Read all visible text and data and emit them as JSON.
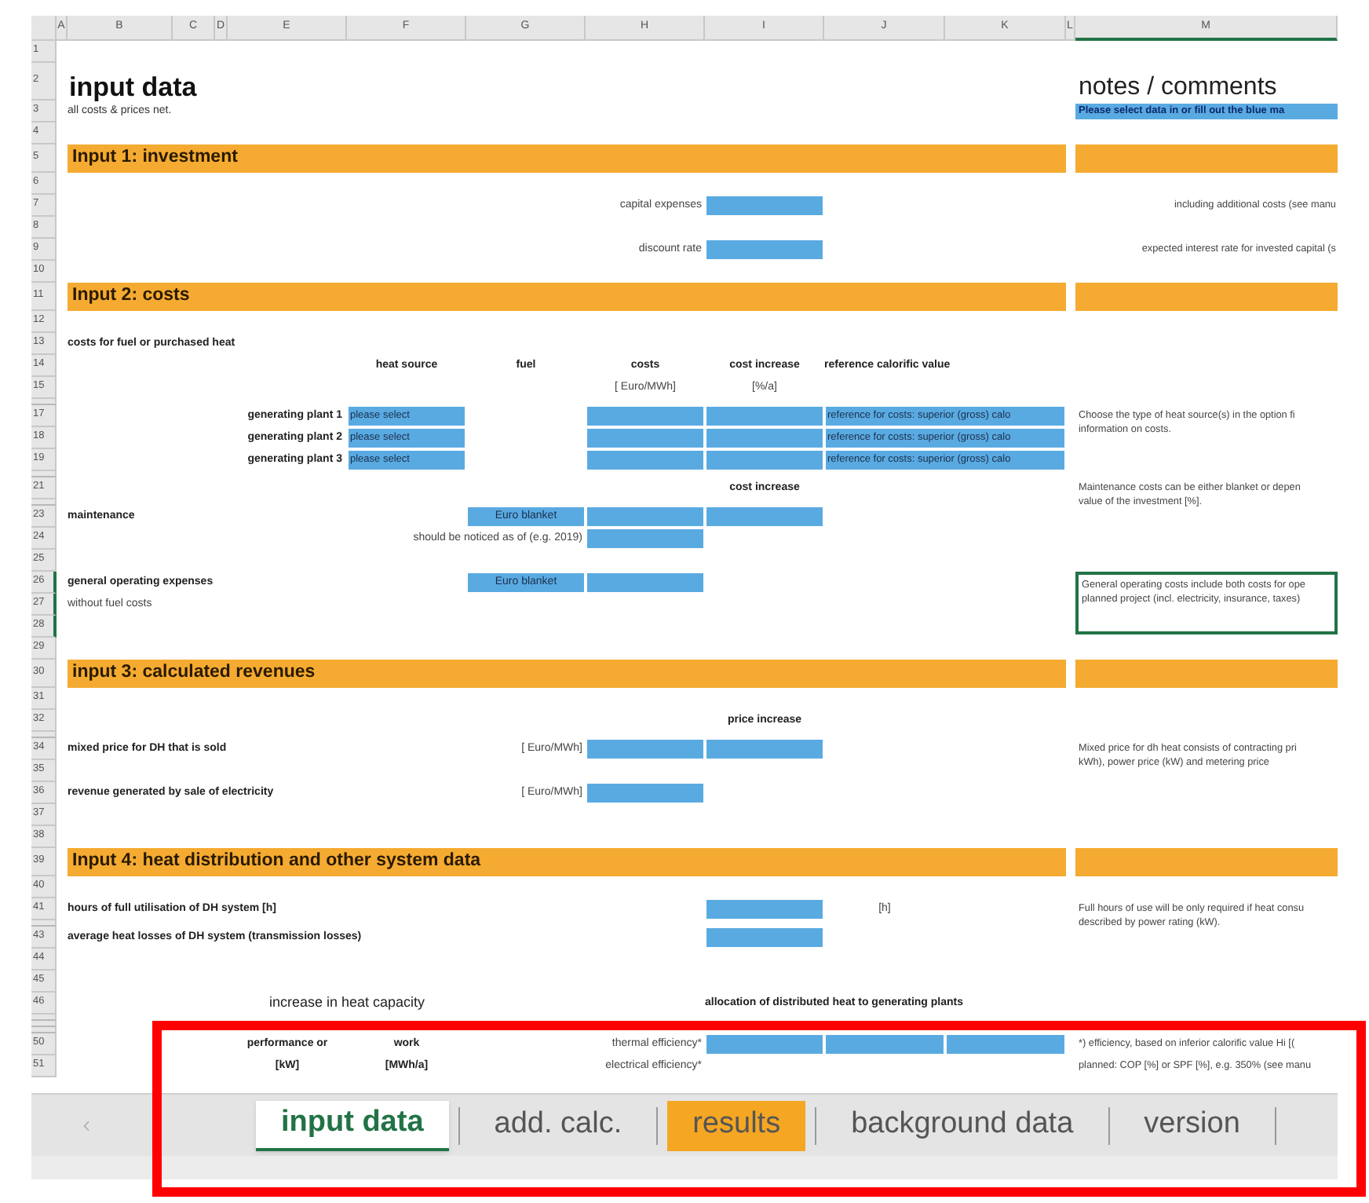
{
  "sheet": {
    "columns": [
      {
        "letter": "A",
        "selected": false
      },
      {
        "letter": "B",
        "selected": false
      },
      {
        "letter": "C",
        "selected": false
      },
      {
        "letter": "D",
        "selected": false
      },
      {
        "letter": "E",
        "selected": false
      },
      {
        "letter": "F",
        "selected": false
      },
      {
        "letter": "G",
        "selected": false
      },
      {
        "letter": "H",
        "selected": false
      },
      {
        "letter": "I",
        "selected": false
      },
      {
        "letter": "J",
        "selected": false
      },
      {
        "letter": "K",
        "selected": false
      },
      {
        "letter": "L",
        "selected": false
      },
      {
        "letter": "M",
        "selected": true
      }
    ],
    "rows": [
      {
        "number": "1",
        "kind": "normal",
        "selected": false
      },
      {
        "number": "2",
        "kind": "title",
        "selected": false,
        "cells": [
          {
            "kind": "empty"
          },
          {
            "kind": "title",
            "text": "input data"
          },
          {
            "kind": "merged"
          },
          {
            "kind": "merged"
          },
          {
            "kind": "merged"
          },
          {
            "kind": "empty"
          },
          {
            "kind": "empty"
          },
          {
            "kind": "empty"
          },
          {
            "kind": "empty"
          },
          {
            "kind": "empty"
          },
          {
            "kind": "empty"
          },
          {
            "kind": "empty"
          },
          {
            "kind": "heading",
            "text": "notes / comments"
          }
        ]
      },
      {
        "number": "3",
        "kind": "normal",
        "selected": false,
        "cells": [
          {
            "kind": "empty"
          },
          {
            "kind": "small",
            "text": "all costs & prices net."
          },
          {
            "kind": "merged"
          },
          {
            "kind": "merged"
          },
          {
            "kind": "merged"
          },
          {
            "kind": "empty"
          },
          {
            "kind": "empty"
          },
          {
            "kind": "empty"
          },
          {
            "kind": "empty"
          },
          {
            "kind": "empty"
          },
          {
            "kind": "empty"
          },
          {
            "kind": "empty"
          },
          {
            "kind": "highlight",
            "text": "Please select data in or fill out the blue ma"
          }
        ]
      },
      {
        "number": "4",
        "kind": "normal",
        "selected": false
      },
      {
        "number": "5",
        "kind": "section",
        "selected": false,
        "cells": [
          {
            "kind": "empty"
          },
          {
            "kind": "section",
            "text": "Input 1: investment"
          },
          {
            "kind": "merged"
          },
          {
            "kind": "merged"
          },
          {
            "kind": "merged"
          },
          {
            "kind": "merged"
          },
          {
            "kind": "merged"
          },
          {
            "kind": "merged"
          },
          {
            "kind": "merged"
          },
          {
            "kind": "merged"
          },
          {
            "kind": "merged"
          },
          {
            "kind": "empty"
          },
          {
            "kind": "band"
          }
        ]
      },
      {
        "number": "6",
        "kind": "normal",
        "selected": false
      },
      {
        "number": "7",
        "kind": "normal",
        "selected": false,
        "cells": [
          {
            "kind": "empty"
          },
          {
            "kind": "empty"
          },
          {
            "kind": "empty"
          },
          {
            "kind": "empty"
          },
          {
            "kind": "empty"
          },
          {
            "kind": "empty"
          },
          {
            "kind": "right",
            "text": "capital expenses"
          },
          {
            "kind": "merged"
          },
          {
            "kind": "input"
          },
          {
            "kind": "empty"
          },
          {
            "kind": "empty"
          },
          {
            "kind": "empty"
          },
          {
            "kind": "note-right",
            "selected": false,
            "lines": [
              "including additional costs (see manu"
            ]
          }
        ]
      },
      {
        "number": "8",
        "kind": "normal",
        "selected": false
      },
      {
        "number": "9",
        "kind": "normal",
        "selected": false,
        "cells": [
          {
            "kind": "empty"
          },
          {
            "kind": "empty"
          },
          {
            "kind": "empty"
          },
          {
            "kind": "empty"
          },
          {
            "kind": "empty"
          },
          {
            "kind": "empty"
          },
          {
            "kind": "right",
            "text": "discount rate"
          },
          {
            "kind": "merged"
          },
          {
            "kind": "input"
          },
          {
            "kind": "empty"
          },
          {
            "kind": "empty"
          },
          {
            "kind": "empty"
          },
          {
            "kind": "note-right",
            "selected": false,
            "lines": [
              "expected interest rate for invested capital (s"
            ]
          }
        ]
      },
      {
        "number": "10",
        "kind": "normal",
        "selected": false
      },
      {
        "number": "11",
        "kind": "section",
        "selected": false,
        "cells": [
          {
            "kind": "empty"
          },
          {
            "kind": "section",
            "text": "Input 2: costs"
          },
          {
            "kind": "merged"
          },
          {
            "kind": "merged"
          },
          {
            "kind": "merged"
          },
          {
            "kind": "merged"
          },
          {
            "kind": "merged"
          },
          {
            "kind": "merged"
          },
          {
            "kind": "merged"
          },
          {
            "kind": "merged"
          },
          {
            "kind": "merged"
          },
          {
            "kind": "empty"
          },
          {
            "kind": "band"
          }
        ]
      },
      {
        "number": "12",
        "kind": "normal",
        "selected": false
      },
      {
        "number": "13",
        "kind": "normal",
        "selected": false,
        "cells": [
          {
            "kind": "empty"
          },
          {
            "kind": "label",
            "text": "costs for fuel or purchased heat"
          },
          {
            "kind": "merged"
          },
          {
            "kind": "merged"
          },
          {
            "kind": "merged"
          }
        ]
      },
      {
        "number": "14",
        "kind": "normal",
        "selected": false,
        "cells": [
          {
            "kind": "empty"
          },
          {
            "kind": "empty"
          },
          {
            "kind": "empty"
          },
          {
            "kind": "empty"
          },
          {
            "kind": "empty"
          },
          {
            "kind": "header",
            "text": "heat source"
          },
          {
            "kind": "header",
            "text": "fuel"
          },
          {
            "kind": "header",
            "text": "costs"
          },
          {
            "kind": "header",
            "text": "cost increase"
          },
          {
            "kind": "label",
            "text": "reference calorific value"
          },
          {
            "kind": "merged"
          }
        ]
      },
      {
        "number": "15",
        "kind": "normal",
        "selected": false,
        "cells": [
          {
            "kind": "empty"
          },
          {
            "kind": "empty"
          },
          {
            "kind": "empty"
          },
          {
            "kind": "empty"
          },
          {
            "kind": "empty"
          },
          {
            "kind": "empty"
          },
          {
            "kind": "empty"
          },
          {
            "kind": "unit",
            "text": "[ Euro/MWh]"
          },
          {
            "kind": "unit",
            "text": "[%/a]"
          }
        ]
      },
      {
        "kind": "thin",
        "selected": false
      },
      {
        "number": "17",
        "kind": "normal",
        "selected": false,
        "cells": [
          {
            "kind": "empty"
          },
          {
            "kind": "empty"
          },
          {
            "kind": "right-bold",
            "text": "generating plant 1"
          },
          {
            "kind": "merged"
          },
          {
            "kind": "merged"
          },
          {
            "kind": "select",
            "text": "please select"
          },
          {
            "kind": "shade"
          },
          {
            "kind": "input"
          },
          {
            "kind": "input"
          },
          {
            "kind": "select",
            "text": "reference for costs: superior (gross) calo"
          },
          {
            "kind": "merged"
          },
          {
            "kind": "empty"
          },
          {
            "kind": "note",
            "selected": false,
            "lines": [
              "Choose the type of heat source(s) in the option fi",
              "information on costs."
            ]
          }
        ]
      },
      {
        "number": "18",
        "kind": "normal",
        "selected": false,
        "cells": [
          {
            "kind": "empty"
          },
          {
            "kind": "empty"
          },
          {
            "kind": "right-bold",
            "text": "generating plant 2"
          },
          {
            "kind": "merged"
          },
          {
            "kind": "merged"
          },
          {
            "kind": "select",
            "text": "please select"
          },
          {
            "kind": "shade"
          },
          {
            "kind": "input"
          },
          {
            "kind": "input"
          },
          {
            "kind": "select",
            "text": "reference for costs: superior (gross) calo"
          },
          {
            "kind": "merged"
          }
        ]
      },
      {
        "number": "19",
        "kind": "normal",
        "selected": false,
        "cells": [
          {
            "kind": "empty"
          },
          {
            "kind": "empty"
          },
          {
            "kind": "right-bold",
            "text": "generating plant 3"
          },
          {
            "kind": "merged"
          },
          {
            "kind": "merged"
          },
          {
            "kind": "select",
            "text": "please select"
          },
          {
            "kind": "shade"
          },
          {
            "kind": "input"
          },
          {
            "kind": "input"
          },
          {
            "kind": "select",
            "text": "reference for costs: superior (gross) calo"
          },
          {
            "kind": "merged"
          }
        ]
      },
      {
        "kind": "thin",
        "selected": false
      },
      {
        "number": "21",
        "kind": "normal",
        "selected": false,
        "cells": [
          {
            "kind": "empty"
          },
          {
            "kind": "empty"
          },
          {
            "kind": "empty"
          },
          {
            "kind": "empty"
          },
          {
            "kind": "empty"
          },
          {
            "kind": "empty"
          },
          {
            "kind": "empty"
          },
          {
            "kind": "empty"
          },
          {
            "kind": "header",
            "text": "cost increase"
          },
          {
            "kind": "empty"
          },
          {
            "kind": "empty"
          },
          {
            "kind": "empty"
          },
          {
            "kind": "note",
            "selected": false,
            "lines": [
              "Maintenance costs can be either blanket or depen",
              "value of the investment [%]."
            ]
          }
        ]
      },
      {
        "kind": "thin",
        "selected": false
      },
      {
        "number": "23",
        "kind": "normal",
        "selected": false,
        "cells": [
          {
            "kind": "empty"
          },
          {
            "kind": "label",
            "text": "maintenance"
          },
          {
            "kind": "merged"
          },
          {
            "kind": "merged"
          },
          {
            "kind": "merged"
          },
          {
            "kind": "empty"
          },
          {
            "kind": "input",
            "text": "Euro blanket"
          },
          {
            "kind": "input"
          },
          {
            "kind": "input"
          }
        ]
      },
      {
        "number": "24",
        "kind": "normal",
        "selected": false,
        "cells": [
          {
            "kind": "empty"
          },
          {
            "kind": "empty"
          },
          {
            "kind": "empty"
          },
          {
            "kind": "empty"
          },
          {
            "kind": "right",
            "text": "should be noticed as of (e.g. 2019)"
          },
          {
            "kind": "merged"
          },
          {
            "kind": "merged"
          },
          {
            "kind": "input"
          }
        ]
      },
      {
        "number": "25",
        "kind": "normal",
        "selected": false
      },
      {
        "number": "26",
        "kind": "normal",
        "selected": true,
        "cells": [
          {
            "kind": "empty"
          },
          {
            "kind": "label",
            "text": "general operating expenses"
          },
          {
            "kind": "merged"
          },
          {
            "kind": "merged"
          },
          {
            "kind": "merged"
          },
          {
            "kind": "empty"
          },
          {
            "kind": "input",
            "text": "Euro blanket"
          },
          {
            "kind": "input"
          },
          {
            "kind": "empty"
          },
          {
            "kind": "empty"
          },
          {
            "kind": "empty"
          },
          {
            "kind": "empty"
          },
          {
            "kind": "note",
            "selected": true,
            "lines": [
              "General operating costs include both costs for ope",
              "planned project (incl. electricity, insurance, taxes)"
            ]
          }
        ]
      },
      {
        "number": "27",
        "kind": "normal",
        "selected": true,
        "cells": [
          {
            "kind": "empty"
          },
          {
            "kind": "text",
            "text": "without fuel costs"
          },
          {
            "kind": "merged"
          },
          {
            "kind": "merged"
          },
          {
            "kind": "merged"
          }
        ]
      },
      {
        "number": "28",
        "kind": "normal",
        "selected": true
      },
      {
        "number": "29",
        "kind": "normal",
        "selected": false
      },
      {
        "number": "30",
        "kind": "section",
        "selected": false,
        "cells": [
          {
            "kind": "empty"
          },
          {
            "kind": "section",
            "text": "input 3: calculated revenues"
          },
          {
            "kind": "merged"
          },
          {
            "kind": "merged"
          },
          {
            "kind": "merged"
          },
          {
            "kind": "merged"
          },
          {
            "kind": "merged"
          },
          {
            "kind": "merged"
          },
          {
            "kind": "merged"
          },
          {
            "kind": "merged"
          },
          {
            "kind": "merged"
          },
          {
            "kind": "empty"
          },
          {
            "kind": "band"
          }
        ]
      },
      {
        "number": "31",
        "kind": "normal",
        "selected": false
      },
      {
        "number": "32",
        "kind": "normal",
        "selected": false,
        "cells": [
          {
            "kind": "empty"
          },
          {
            "kind": "empty"
          },
          {
            "kind": "empty"
          },
          {
            "kind": "empty"
          },
          {
            "kind": "empty"
          },
          {
            "kind": "empty"
          },
          {
            "kind": "empty"
          },
          {
            "kind": "empty"
          },
          {
            "kind": "header",
            "text": "price increase"
          }
        ]
      },
      {
        "kind": "thin",
        "selected": false
      },
      {
        "number": "34",
        "kind": "normal",
        "selected": false,
        "cells": [
          {
            "kind": "empty"
          },
          {
            "kind": "label",
            "text": "mixed price for DH that is sold"
          },
          {
            "kind": "merged"
          },
          {
            "kind": "merged"
          },
          {
            "kind": "merged"
          },
          {
            "kind": "empty"
          },
          {
            "kind": "right",
            "text": "[ Euro/MWh]"
          },
          {
            "kind": "input"
          },
          {
            "kind": "input"
          },
          {
            "kind": "empty"
          },
          {
            "kind": "empty"
          },
          {
            "kind": "empty"
          },
          {
            "kind": "note",
            "selected": false,
            "lines": [
              "Mixed price for dh heat consists of contracting pri",
              "kWh), power price (kW) and metering price"
            ]
          }
        ]
      },
      {
        "number": "35",
        "kind": "normal",
        "selected": false
      },
      {
        "number": "36",
        "kind": "normal",
        "selected": false,
        "cells": [
          {
            "kind": "empty"
          },
          {
            "kind": "label",
            "text": "revenue generated by sale of electricity"
          },
          {
            "kind": "merged"
          },
          {
            "kind": "merged"
          },
          {
            "kind": "merged"
          },
          {
            "kind": "empty"
          },
          {
            "kind": "right",
            "text": "[ Euro/MWh]"
          },
          {
            "kind": "input"
          }
        ]
      },
      {
        "number": "37",
        "kind": "normal",
        "selected": false
      },
      {
        "number": "38",
        "kind": "normal",
        "selected": false
      },
      {
        "number": "39",
        "kind": "section",
        "selected": false,
        "cells": [
          {
            "kind": "empty"
          },
          {
            "kind": "section",
            "text": "Input 4: heat distribution and other system data"
          },
          {
            "kind": "merged"
          },
          {
            "kind": "merged"
          },
          {
            "kind": "merged"
          },
          {
            "kind": "merged"
          },
          {
            "kind": "merged"
          },
          {
            "kind": "merged"
          },
          {
            "kind": "merged"
          },
          {
            "kind": "merged"
          },
          {
            "kind": "merged"
          },
          {
            "kind": "empty"
          },
          {
            "kind": "band"
          }
        ]
      },
      {
        "number": "40",
        "kind": "normal",
        "selected": false
      },
      {
        "number": "41",
        "kind": "normal",
        "selected": false,
        "cells": [
          {
            "kind": "empty"
          },
          {
            "kind": "label",
            "text": "hours of full utilisation of DH system [h]"
          },
          {
            "kind": "merged"
          },
          {
            "kind": "merged"
          },
          {
            "kind": "merged"
          },
          {
            "kind": "merged"
          },
          {
            "kind": "empty"
          },
          {
            "kind": "empty"
          },
          {
            "kind": "input"
          },
          {
            "kind": "unit",
            "text": "[h]"
          },
          {
            "kind": "empty"
          },
          {
            "kind": "empty"
          },
          {
            "kind": "note",
            "selected": false,
            "lines": [
              "Full hours of use will be only required if heat consu",
              "described by power rating (kW)."
            ]
          }
        ]
      },
      {
        "kind": "thin",
        "selected": false
      },
      {
        "number": "43",
        "kind": "normal",
        "selected": false,
        "cells": [
          {
            "kind": "empty"
          },
          {
            "kind": "label",
            "text": "average heat losses of DH system (transmission losses)"
          },
          {
            "kind": "merged"
          },
          {
            "kind": "merged"
          },
          {
            "kind": "merged"
          },
          {
            "kind": "merged"
          },
          {
            "kind": "empty"
          },
          {
            "kind": "empty"
          },
          {
            "kind": "input"
          }
        ]
      },
      {
        "number": "44",
        "kind": "normal",
        "selected": false
      },
      {
        "number": "45",
        "kind": "normal",
        "selected": false
      },
      {
        "number": "46",
        "kind": "normal",
        "selected": false,
        "cells": [
          {
            "kind": "empty"
          },
          {
            "kind": "empty"
          },
          {
            "kind": "empty"
          },
          {
            "kind": "empty"
          },
          {
            "kind": "subhead",
            "text": "increase in heat capacity"
          },
          {
            "kind": "merged"
          },
          {
            "kind": "empty"
          },
          {
            "kind": "empty"
          },
          {
            "kind": "label",
            "text": "allocation of distributed heat to generating plants"
          },
          {
            "kind": "merged"
          },
          {
            "kind": "merged"
          }
        ]
      },
      {
        "kind": "thin",
        "selected": false
      },
      {
        "kind": "thin",
        "selected": false
      },
      {
        "kind": "thin",
        "selected": false
      },
      {
        "number": "50",
        "kind": "normal",
        "selected": false,
        "cells": [
          {
            "kind": "empty"
          },
          {
            "kind": "empty"
          },
          {
            "kind": "empty"
          },
          {
            "kind": "empty"
          },
          {
            "kind": "header",
            "text": "performance or"
          },
          {
            "kind": "header",
            "text": "work"
          },
          {
            "kind": "right",
            "text": "thermal efficiency*"
          },
          {
            "kind": "merged"
          },
          {
            "kind": "input"
          },
          {
            "kind": "input"
          },
          {
            "kind": "input"
          },
          {
            "kind": "empty"
          },
          {
            "kind": "note",
            "selected": false,
            "lines": [
              "*) efficiency, based on inferior calorific value Hi [("
            ]
          }
        ]
      },
      {
        "number": "51",
        "kind": "normal",
        "selected": false,
        "cells": [
          {
            "kind": "empty"
          },
          {
            "kind": "empty"
          },
          {
            "kind": "empty"
          },
          {
            "kind": "empty"
          },
          {
            "kind": "header",
            "text": "[kW]"
          },
          {
            "kind": "header",
            "text": "[MWh/a]"
          },
          {
            "kind": "right",
            "text": "electrical efficiency*"
          },
          {
            "kind": "merged"
          },
          {
            "kind": "shade"
          },
          {
            "kind": "shade"
          },
          {
            "kind": "shade"
          },
          {
            "kind": "empty"
          },
          {
            "kind": "note",
            "selected": false,
            "lines": [
              "planned: COP [%] or SPF [%], e.g. 350% (see manu"
            ]
          }
        ]
      }
    ]
  },
  "tabs": [
    {
      "label": "input data",
      "selected": true
    },
    {
      "label": "add. calc.",
      "selected": false
    },
    {
      "label": "results",
      "selected": false,
      "color": "#f5a623"
    },
    {
      "label": "background data",
      "selected": false
    },
    {
      "label": "version",
      "selected": false
    }
  ],
  "annotation": {
    "kind": "frame"
  }
}
